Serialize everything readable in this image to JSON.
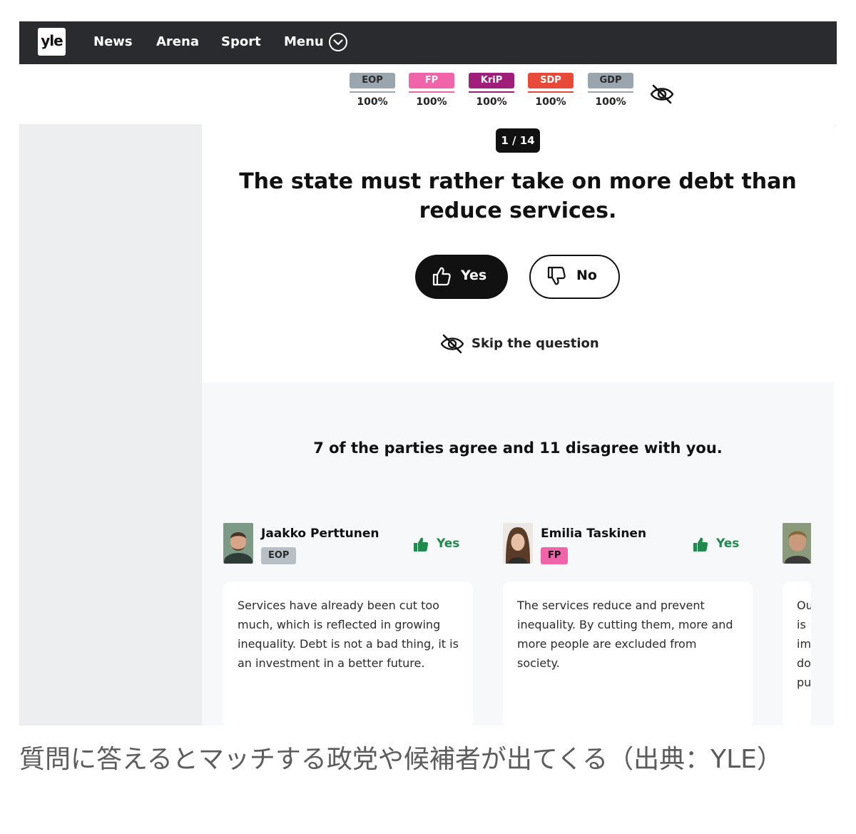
{
  "nav": {
    "logo": "yle",
    "links": [
      "News",
      "Arena",
      "Sport",
      "Menu"
    ]
  },
  "parties": [
    {
      "abbr": "EOP",
      "percent": "100%",
      "color": "#9aa5ae",
      "text_color": "#2b2b2b"
    },
    {
      "abbr": "FP",
      "percent": "100%",
      "color": "#f064aa",
      "text_color": "#ffffff"
    },
    {
      "abbr": "KriP",
      "percent": "100%",
      "color": "#a01e79",
      "text_color": "#ffffff"
    },
    {
      "abbr": "SDP",
      "percent": "100%",
      "color": "#e84a3a",
      "text_color": "#ffffff"
    },
    {
      "abbr": "GDP",
      "percent": "100%",
      "color": "#9aa5ae",
      "text_color": "#2b2b2b"
    }
  ],
  "question": {
    "counter": "1 / 14",
    "text": "The state must rather take on more debt than reduce services.",
    "yes_label": "Yes",
    "no_label": "No",
    "skip_label": "Skip the question"
  },
  "results": {
    "summary": "7 of the parties agree and 11 disagree with you.",
    "candidates": [
      {
        "name": "Jaakko Perttunen",
        "party": "EOP",
        "party_color": "#b8c0c6",
        "party_text_color": "#2b2b2b",
        "answer": "Yes",
        "comment": "Services have already been cut too much, which is reflected in growing inequality. Debt is not a bad thing, it is an investment in a better future."
      },
      {
        "name": "Emilia Taskinen",
        "party": "FP",
        "party_color": "#f064aa",
        "party_text_color": "#111111",
        "answer": "Yes",
        "comment": "The services reduce and prevent inequality. By cutting them, more and more people are excluded from society."
      },
      {
        "name": "",
        "party": "",
        "answer": "",
        "comment": "Ou\nis\nim\ndo\npu"
      }
    ]
  },
  "caption": "質問に答えるとマッチする政党や候補者が出てくる（出典：YLE）"
}
